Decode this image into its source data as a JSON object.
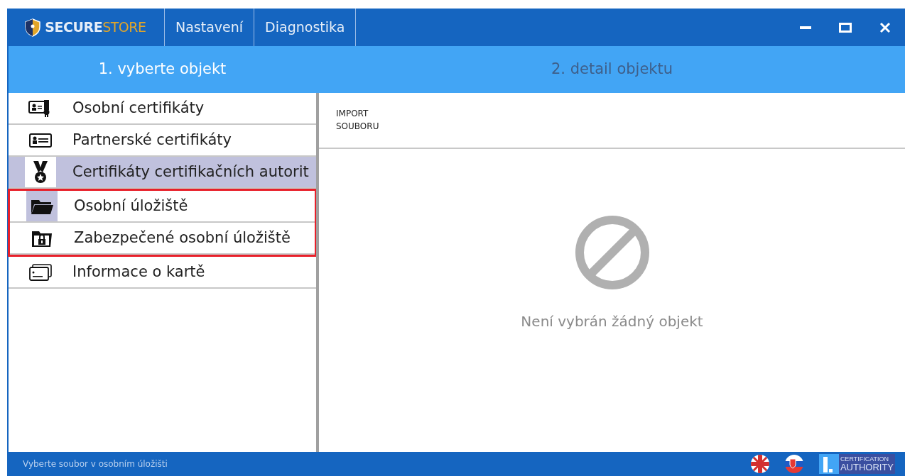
{
  "app": {
    "logo_primary": "SECURE",
    "logo_secondary": "STORE"
  },
  "menu": [
    {
      "label": "Nastavení"
    },
    {
      "label": "Diagnostika"
    }
  ],
  "steps": [
    {
      "label": "1. vyberte objekt"
    },
    {
      "label": "2. detail objektu"
    }
  ],
  "objects": [
    {
      "label": "Osobní certifikáty",
      "kind": "certificate",
      "selected": false,
      "icon_highlighted": false,
      "outlined": false
    },
    {
      "label": "Partnerské certifikáty",
      "kind": "card",
      "selected": false,
      "icon_highlighted": false,
      "outlined": false
    },
    {
      "label": "Certifikáty certifikačních autorit",
      "kind": "medal",
      "selected": true,
      "icon_highlighted": false,
      "outlined": false
    },
    {
      "label": "Osobní úložiště",
      "kind": "folder",
      "selected": false,
      "icon_highlighted": true,
      "outlined": true
    },
    {
      "label": "Zabezpečené osobní úložiště",
      "kind": "locked-folder",
      "selected": false,
      "icon_highlighted": false,
      "outlined": true
    },
    {
      "label": "Informace o kartě",
      "kind": "cards",
      "selected": false,
      "icon_highlighted": false,
      "outlined": false
    }
  ],
  "toolbar": [
    {
      "label": "IMPORT SOUBORU"
    }
  ],
  "empty_state": {
    "message": "Není vybrán žádný objekt"
  },
  "status_bar": {
    "message": "Vyberte soubor v osobním úložišti",
    "badge_top": "CERTIFICATION",
    "badge_bottom": "AUTHORITY"
  }
}
